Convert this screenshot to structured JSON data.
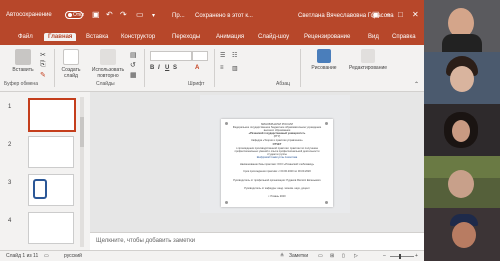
{
  "titlebar": {
    "autosave_label": "Автосохранение",
    "autosave_state": "Откл",
    "file_name": "Пр...",
    "saved_status": "Сохранено в этот к...",
    "user_name": "Светлана Вячеславовна Горасова",
    "colors": {
      "brand": "#b7472a",
      "accent": "#c43e1c"
    }
  },
  "tabs": [
    "Файл",
    "Главная",
    "Вставка",
    "Конструктор",
    "Переходы",
    "Анимация",
    "Слайд-шоу",
    "Рецензирование",
    "Вид",
    "Справка"
  ],
  "ribbon": {
    "paste": "Вставить",
    "new_slide": "Создать слайд",
    "reuse": "Использовать повторно",
    "drawing": "Рисование",
    "editing": "Редактирование",
    "groups": [
      "Буфер обмена",
      "Слайды",
      "Шрифт",
      "Абзац"
    ]
  },
  "thumbnails": [
    "1",
    "2",
    "3",
    "4"
  ],
  "slide": {
    "lines": [
      "МИНОБРНАУКИ РОССИИ",
      "Федеральное государственное бюджетное образовательное учреждение",
      "высшего образования",
      "«Рязанский государственный университет»",
      "(РГУ)",
      "Кафедра «Теории и практики управления»",
      "ОТЧЕТ",
      "о прохождении производственной практики: практики по получению",
      "профессиональных умений и опыта профессиональной деятельности",
      "студента группы",
      "Шифровой Самигуллы Азизотова",
      "Наименование базы практики: ООО «Рязанский хлебозавод»",
      "Срок прохождения практики: с 00.00.2020 по 00.00.2020",
      "Руководитель от профильной организации: Рудаков Филипп Евгеньевич",
      "Руководитель от кафедры: канд. эконом. наук, доцент",
      "г. Рязань 2020"
    ]
  },
  "notes_placeholder": "Щелкните, чтобы добавить заметки",
  "status": {
    "slide_counter": "Слайд 1 из 11",
    "language": "русский",
    "notes_btn": "Заметки",
    "zoom": "45 %"
  },
  "video_panel": [
    {
      "label": ""
    },
    {
      "label": ""
    },
    {
      "label": ""
    },
    {
      "label": ""
    },
    {
      "label": ""
    }
  ]
}
